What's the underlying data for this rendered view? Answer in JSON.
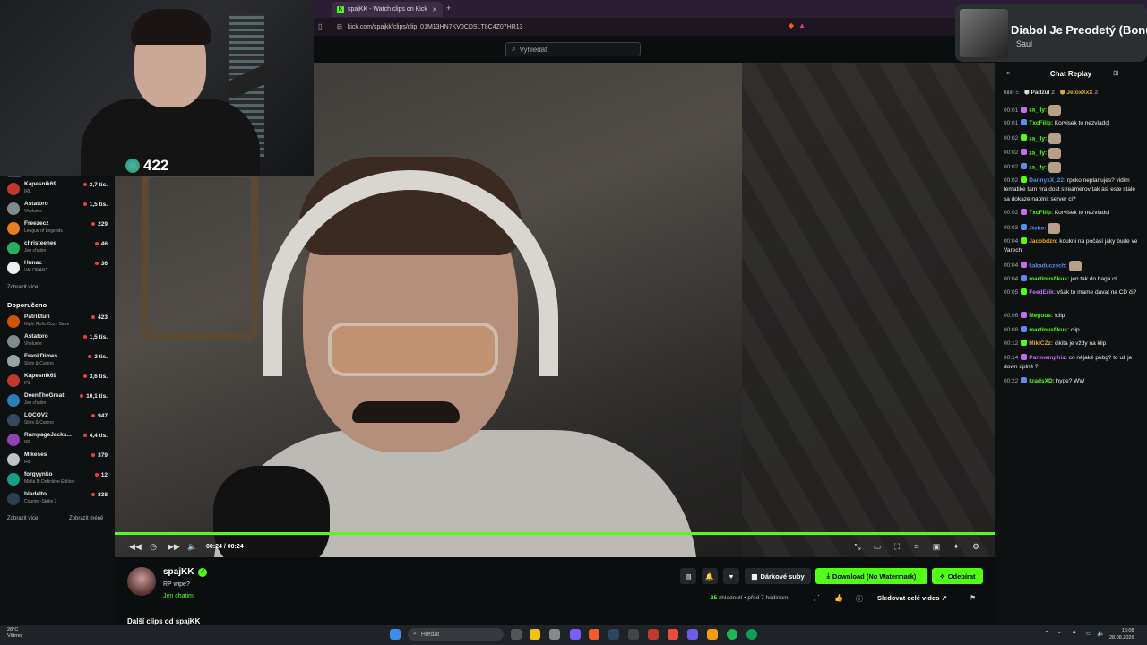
{
  "browser": {
    "tab_title": "spajKK - Watch clips on Kick",
    "tab_favicon": "K",
    "url": "kick.com/spajkk/clips/clip_01M13HN7KV0CDS1T8C4Z07HR13"
  },
  "header": {
    "search_placeholder": "Vyhledat"
  },
  "overlay": {
    "viewer_count": "422",
    "song_title": "Diabol Je Preodetý (Bonu",
    "song_artist": "Saul"
  },
  "sidebar": {
    "following": [
      {
        "name": "Kapesnik69",
        "category": "IRL",
        "viewers": "3,7 tis.",
        "color": "#c0392b"
      },
      {
        "name": "Astatoro",
        "category": "Vhelume",
        "viewers": "1,5 tis.",
        "color": "#7f8c8d"
      },
      {
        "name": "Freezecz",
        "category": "League of Legends",
        "viewers": "229",
        "color": "#e67e22"
      },
      {
        "name": "christeenee",
        "category": "Jen chatim",
        "viewers": "46",
        "color": "#27ae60"
      },
      {
        "name": "Hunac",
        "category": "VALORANT",
        "viewers": "36",
        "color": "#ecf0f1"
      }
    ],
    "show_more_1": "Zobrazit více",
    "recommended_header": "Doporučeno",
    "recommended": [
      {
        "name": "Patrikturi",
        "category": "Night Rolls Cozy Store",
        "viewers": "423",
        "color": "#d35400"
      },
      {
        "name": "Astatoro",
        "category": "Vhelume",
        "viewers": "1,5 tis.",
        "color": "#7f8c8d"
      },
      {
        "name": "FrankDimes",
        "category": "Slots & Casino",
        "viewers": "3 tis.",
        "color": "#95a5a6"
      },
      {
        "name": "Kapesnik69",
        "category": "IRL",
        "viewers": "3,6 tis.",
        "color": "#c0392b"
      },
      {
        "name": "DeenTheGreat",
        "category": "Jen chatim",
        "viewers": "10,1 tis.",
        "color": "#2980b9"
      },
      {
        "name": "LOCOV2",
        "category": "Slots & Casino",
        "viewers": "947",
        "color": "#34495e"
      },
      {
        "name": "RampageJacks...",
        "category": "IRL",
        "viewers": "4,4 tis.",
        "color": "#8e44ad"
      },
      {
        "name": "Mikeses",
        "category": "IRL",
        "viewers": "379",
        "color": "#bdc3c7"
      },
      {
        "name": "forgyynko",
        "category": "Mafia II: Definitive Edition",
        "viewers": "12",
        "color": "#16a085"
      },
      {
        "name": "bladelto",
        "category": "Counter-Strike 2",
        "viewers": "838",
        "color": "#2c3e50"
      }
    ],
    "show_more_2": "Zobrazit více",
    "show_less": "Zobrazit méně"
  },
  "player": {
    "time": "00:24 / 00:24",
    "progress": 1.0
  },
  "chat": {
    "title": "Chat Replay",
    "leaderboard": [
      {
        "name": "hilin",
        "count": "5"
      },
      {
        "name": "Padzul",
        "count": "2"
      },
      {
        "name": "JetoxXxX",
        "count": "2"
      }
    ],
    "messages": [
      {
        "time": "00:01",
        "user": "za_lly:",
        "color": "#53fc18",
        "text": "",
        "emote": true
      },
      {
        "time": "00:01",
        "user": "TxcFilip:",
        "color": "#53fc18",
        "text": "Korvisek to nezvladol",
        "emote": false
      },
      {
        "time": "00:02",
        "user": "za_lly:",
        "color": "#53fc18",
        "text": "",
        "emote": true
      },
      {
        "time": "00:02",
        "user": "za_lly:",
        "color": "#53fc18",
        "text": "",
        "emote": true
      },
      {
        "time": "00:02",
        "user": "za_lly:",
        "color": "#53fc18",
        "text": "",
        "emote": true
      },
      {
        "time": "00:02",
        "user": "DannyxX_22:",
        "color": "#5b8def",
        "text": "rpcko neplanujes? vidim tematike tam hra dost streamerov tak asi este stale sa dokaze naplnit server ci?",
        "emote": false
      },
      {
        "time": "00:02",
        "user": "TxcFilip:",
        "color": "#53fc18",
        "text": "Korvisek to nezvladol",
        "emote": false
      },
      {
        "time": "00:03",
        "user": "Jtcko:",
        "color": "#5b8def",
        "text": "",
        "emote": true
      },
      {
        "time": "00:04",
        "user": "Jacobdzn:",
        "color": "#e5a93b",
        "text": "koukni na počasí jaky bude ve Varech",
        "emote": false
      },
      {
        "time": "00:04",
        "user": "kakaduczech:",
        "color": "#5b8def",
        "text": "",
        "emote": true
      },
      {
        "time": "00:04",
        "user": "martinusfikus:",
        "color": "#53fc18",
        "text": "jen tak do baga cli",
        "emote": false
      },
      {
        "time": "00:05",
        "user": "FeedErik:",
        "color": "#c56cf0",
        "text": "však to mame davat na CD či?",
        "emote": false
      },
      {
        "time": "00:06",
        "user": "Megous:",
        "color": "#53fc18",
        "text": "!clip",
        "emote": false
      },
      {
        "time": "00:08",
        "user": "martinusfikus:",
        "color": "#53fc18",
        "text": "clip",
        "emote": false
      },
      {
        "time": "00:12",
        "user": "MikiCZz:",
        "color": "#e5a93b",
        "text": "čikita je vždy na klip",
        "emote": false
      },
      {
        "time": "00:14",
        "user": "Panmemphis:",
        "color": "#c56cf0",
        "text": "co nějaké pubg? to už je down úplně ?",
        "emote": false
      },
      {
        "time": "00:22",
        "user": "kradsXD:",
        "color": "#53fc18",
        "text": "hype? WW",
        "emote": false
      }
    ]
  },
  "info": {
    "channel": "spajKK",
    "clip_title": "RP wipe?",
    "category": "Jen chatim",
    "gift_label": "Dárkové suby",
    "download_label": "Download (No Watermark)",
    "follow_label": "Odebírat",
    "views_count": "35",
    "views_suffix": "zhlednutí",
    "ago": "• před 7 hodinami",
    "watch_full": "Sledovat celé video",
    "more_clips": "Další clips od spajKK"
  },
  "taskbar": {
    "temp": "28°C",
    "weather": "Větrno",
    "search": "Hledat",
    "time": "16:08",
    "date": "28.08.2026"
  },
  "colors": {
    "accent": "#53fc18",
    "bg": "#0b0e0f"
  }
}
